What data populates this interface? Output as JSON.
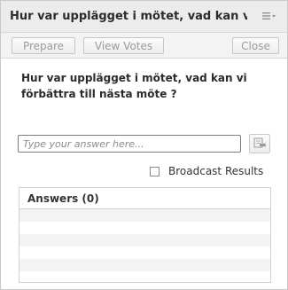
{
  "header": {
    "title": "Hur var upplägget i mötet, vad kan vi...",
    "menu_icon": "hamburger-menu-icon"
  },
  "toolbar": {
    "prepare_label": "Prepare",
    "view_votes_label": "View Votes",
    "close_label": "Close"
  },
  "question": {
    "text": "Hur var upplägget i mötet, vad kan vi förbättra till nästa möte ?"
  },
  "answer_input": {
    "placeholder": "Type your answer here...",
    "value": ""
  },
  "send_button": {
    "icon": "send-icon"
  },
  "broadcast": {
    "label": "Broadcast Results",
    "checked": false
  },
  "answers": {
    "header": "Answers (0)",
    "rows": []
  }
}
